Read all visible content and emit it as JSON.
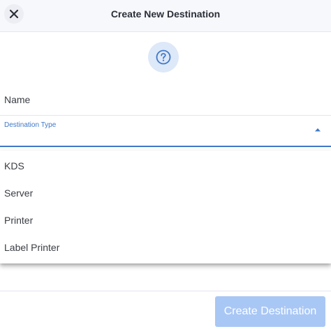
{
  "header": {
    "title": "Create New Destination",
    "close_icon": "close-icon"
  },
  "help": {
    "icon": "question-circle-icon",
    "color": "#3f78c7"
  },
  "form": {
    "name_label": "Name",
    "destination_type": {
      "label": "Destination Type",
      "value": "",
      "expanded": true,
      "options": [
        "KDS",
        "Server",
        "Printer",
        "Label Printer"
      ]
    }
  },
  "footer": {
    "create_label": "Create Destination",
    "disabled": true
  },
  "colors": {
    "accent": "#3f78c7",
    "button_disabled": "#a9c7f5"
  }
}
